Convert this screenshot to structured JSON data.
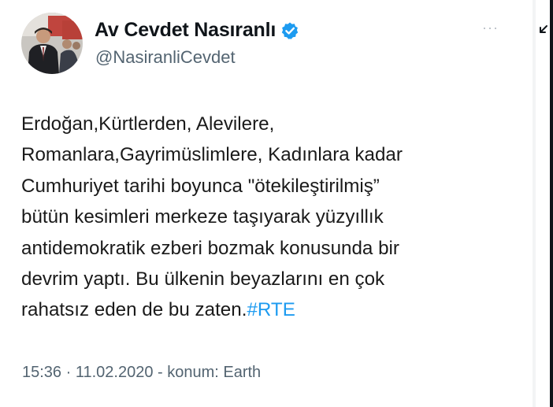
{
  "tweet": {
    "display_name": "Av Cevdet Nasıranlı",
    "handle": "@NasiranliCevdet",
    "more_label": "···",
    "text_body": "Erdoğan,Kürtlerden, Alevilere,\nRomanlara,Gayrimüslimlere, Kadınlara kadar\nCumhuriyet tarihi boyunca \"ötekileştirilmiş”\nbütün kesimleri merkeze taşıyarak yüzyıllık\nantidemokratik ezberi bozmak konusunda bir\ndevrim yaptı. Bu ülkenin beyazlarını en çok\nrahatsız eden de bu zaten.",
    "hashtag": "#RTE",
    "meta": "15:36 · 11.02.2020 - konum: Earth"
  },
  "icons": {
    "verified": "verified-badge-icon",
    "avatar": "profile-photo",
    "arrow": "expand-arrow-icon"
  },
  "colors": {
    "verified": "#1d9bf0",
    "hashtag": "#1d9bf0",
    "secondary_text": "#536471",
    "primary_text": "#0f1419"
  }
}
